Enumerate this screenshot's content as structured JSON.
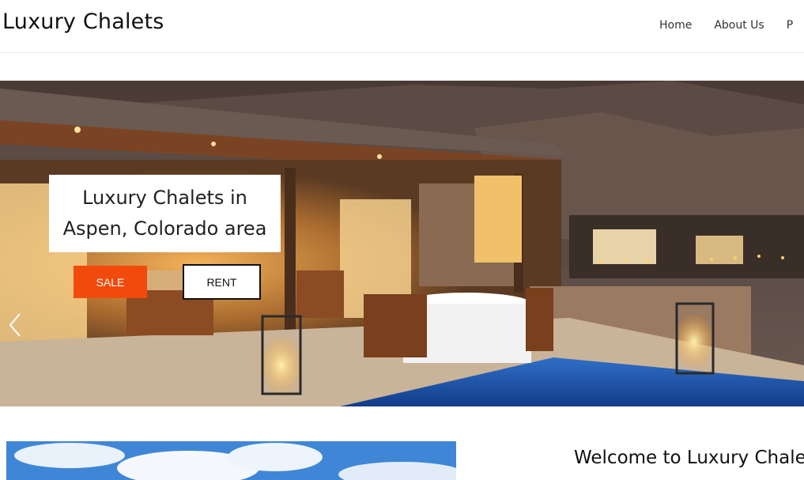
{
  "site": {
    "title": "Luxury Chalets"
  },
  "nav": {
    "items": [
      "Home",
      "About Us",
      "P"
    ]
  },
  "hero": {
    "caption_line1": "Luxury Chalets in",
    "caption_line2": "Aspen, Colorado area",
    "sale_label": "SALE",
    "rent_label": "RENT",
    "accent_color": "#f24a0c"
  },
  "section": {
    "welcome_heading": "Welcome to Luxury Chale"
  }
}
